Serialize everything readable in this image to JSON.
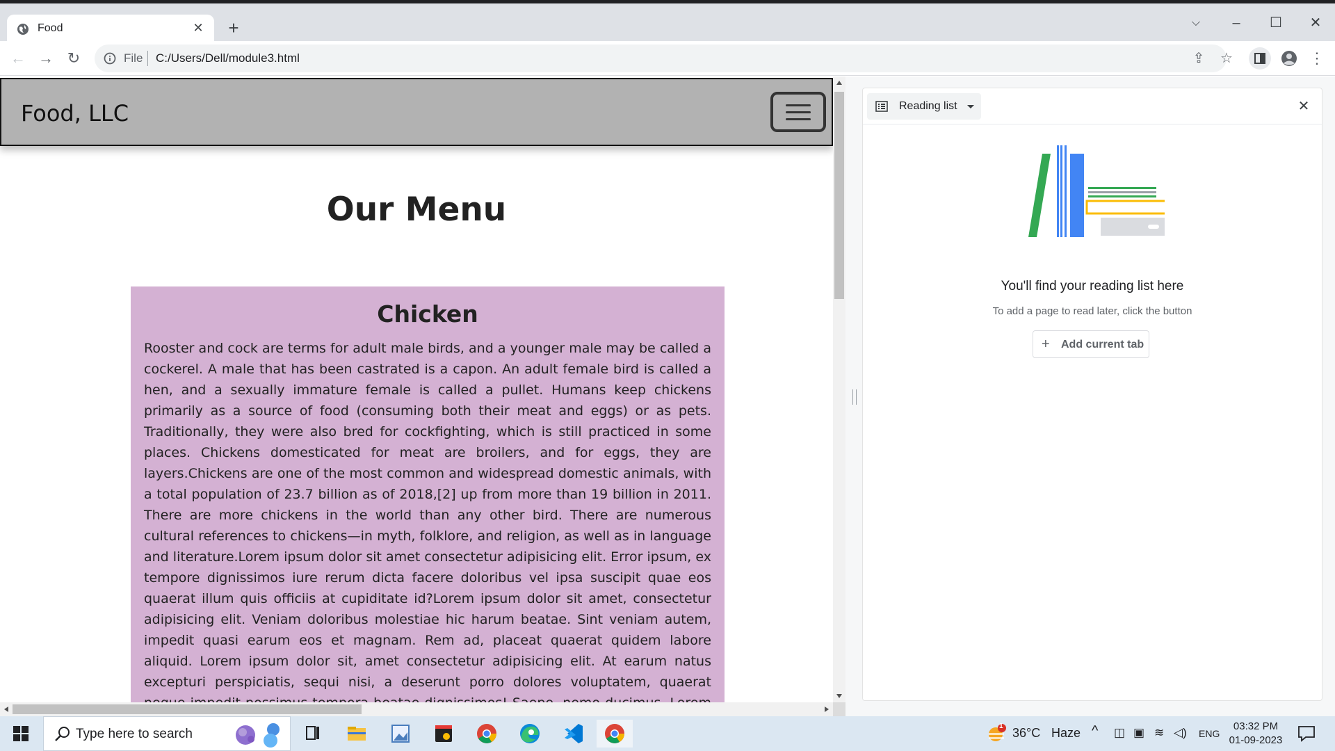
{
  "browser": {
    "tab_title": "Food",
    "url_scheme": "File",
    "url": "C:/Users/Dell/module3.html"
  },
  "page": {
    "brand": "Food, LLC",
    "menu_title": "Our Menu",
    "card": {
      "title": "Chicken",
      "text": "Rooster and cock are terms for adult male birds, and a younger male may be called a cockerel. A male that has been castrated is a capon. An adult female bird is called a hen, and a sexually immature female is called a pullet. Humans keep chickens primarily as a source of food (consuming both their meat and eggs) or as pets. Traditionally, they were also bred for cockfighting, which is still practiced in some places. Chickens domesticated for meat are broilers, and for eggs, they are layers.Chickens are one of the most common and widespread domestic animals, with a total population of 23.7 billion as of 2018,[2] up from more than 19 billion in 2011. There are more chickens in the world than any other bird. There are numerous cultural references to chickens—in myth, folklore, and religion, as well as in language and literature.Lorem ipsum dolor sit amet consectetur adipisicing elit. Error ipsum, ex tempore dignissimos iure rerum dicta facere doloribus vel ipsa suscipit quae eos quaerat illum quis officiis at cupiditate id?Lorem ipsum dolor sit amet, consectetur adipisicing elit. Veniam doloribus molestiae hic harum beatae. Sint veniam autem, impedit quasi earum eos et magnam. Rem ad, placeat quaerat quidem labore aliquid. Lorem ipsum dolor sit, amet consectetur adipisicing elit. At earum natus excepturi perspiciatis, sequi nisi, a deserunt porro dolores voluptatem, quaerat neque impedit possimus tempora beatae dignissimos! Saepe, nemo ducimus. Lorem ipsum dolor sit amet consectetur, adipisicing elit. Veritatis quidem, illum natus atque eius repellendus similique voluptate officiis, quae soluta amet"
    }
  },
  "side_panel": {
    "selector_label": "Reading list",
    "heading": "You'll find your reading list here",
    "subtext": "To add a page to read later, click the button",
    "add_button_label": "Add current tab"
  },
  "taskbar": {
    "search_placeholder": "Type here to search",
    "weather_temp": "36°C",
    "weather_desc": "Haze",
    "weather_badge": "1",
    "language": "ENG",
    "time": "03:32 PM",
    "date": "01-09-2023"
  },
  "colors": {
    "navbar": "#b2b2b2",
    "card": "#d4b1d3",
    "taskbar": "#dbe7f2"
  },
  "icons": [
    "globe-icon",
    "close-icon",
    "plus-icon",
    "back-icon",
    "forward-icon",
    "reload-icon",
    "info-icon",
    "share-icon",
    "star-icon",
    "side-panel-icon",
    "profile-icon",
    "more-icon",
    "hamburger-icon",
    "reading-list-icon",
    "windows-icon",
    "search-icon"
  ]
}
